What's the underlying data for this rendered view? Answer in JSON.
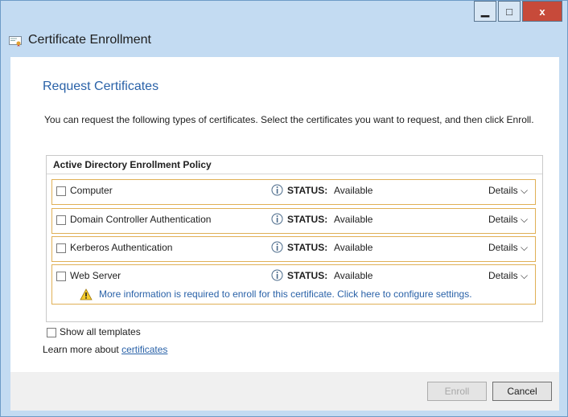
{
  "window": {
    "title": "Certificate Enrollment",
    "controls": {
      "minimize": "▁",
      "maximize": "□",
      "close": "x"
    }
  },
  "page": {
    "heading": "Request Certificates",
    "description": "You can request the following types of certificates. Select the certificates you want to request, and then click Enroll."
  },
  "policy": {
    "name": "Active Directory Enrollment Policy",
    "items": [
      {
        "label": "Computer",
        "checked": false,
        "status_label": "STATUS:",
        "status": "Available",
        "details": "Details ⌵"
      },
      {
        "label": "Domain Controller Authentication",
        "checked": false,
        "status_label": "STATUS:",
        "status": "Available",
        "details": "Details ⌵"
      },
      {
        "label": "Kerberos Authentication",
        "checked": false,
        "status_label": "STATUS:",
        "status": "Available",
        "details": "Details ⌵"
      },
      {
        "label": "Web Server",
        "checked": false,
        "status_label": "STATUS:",
        "status": "Available",
        "details": "Details ⌵",
        "warning": "More information is required to enroll for this certificate. Click here to configure settings."
      }
    ]
  },
  "options": {
    "show_all_templates": "Show all templates",
    "show_all_checked": false,
    "learn_more_prefix": "Learn more about ",
    "learn_more_link": "certificates"
  },
  "buttons": {
    "enroll": "Enroll",
    "cancel": "Cancel"
  },
  "colors": {
    "title_bar": "#c3dbf2",
    "accent": "#2a62a8",
    "row_border": "#e0b056",
    "close_button": "#c74a3a"
  }
}
